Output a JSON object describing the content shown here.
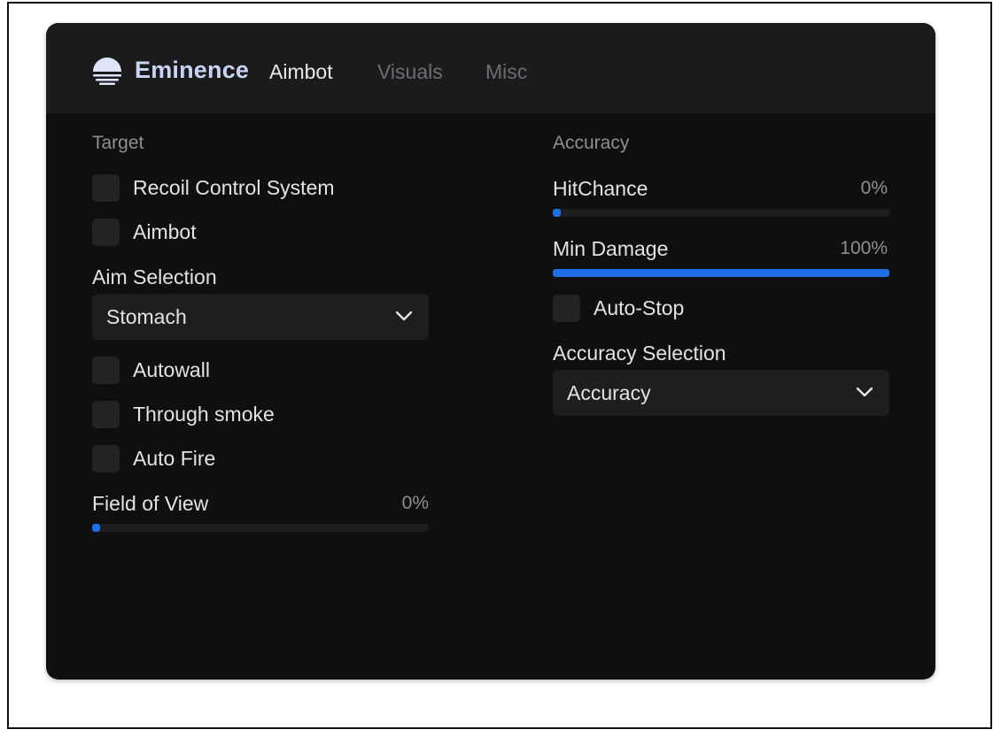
{
  "header": {
    "brand": "Eminence",
    "tabs": [
      {
        "label": "Aimbot",
        "active": true
      },
      {
        "label": "Visuals",
        "active": false
      },
      {
        "label": "Misc",
        "active": false
      }
    ]
  },
  "left": {
    "section_title": "Target",
    "checkboxes_top": [
      {
        "label": "Recoil Control System",
        "checked": false
      },
      {
        "label": "Aimbot",
        "checked": false
      }
    ],
    "aim_selection": {
      "label": "Aim Selection",
      "value": "Stomach"
    },
    "checkboxes_bottom": [
      {
        "label": "Autowall",
        "checked": false
      },
      {
        "label": "Through smoke",
        "checked": false
      },
      {
        "label": "Auto Fire",
        "checked": false
      }
    ],
    "fov_slider": {
      "label": "Field of View",
      "value_text": "0%",
      "value": 0
    }
  },
  "right": {
    "section_title": "Accuracy",
    "hitchance_slider": {
      "label": "HitChance",
      "value_text": "0%",
      "value": 0
    },
    "min_damage_slider": {
      "label": "Min Damage",
      "value_text": "100%",
      "value": 100
    },
    "auto_stop": {
      "label": "Auto-Stop",
      "checked": false
    },
    "accuracy_selection": {
      "label": "Accuracy Selection",
      "value": "Accuracy"
    }
  },
  "colors": {
    "accent": "#1f6fe6",
    "background": "#0f0f10",
    "header": "#1b1b1d",
    "brand": "#c9d3f2"
  },
  "icons": {
    "logo": "sunset-logo-icon",
    "chevron": "chevron-down-icon"
  }
}
